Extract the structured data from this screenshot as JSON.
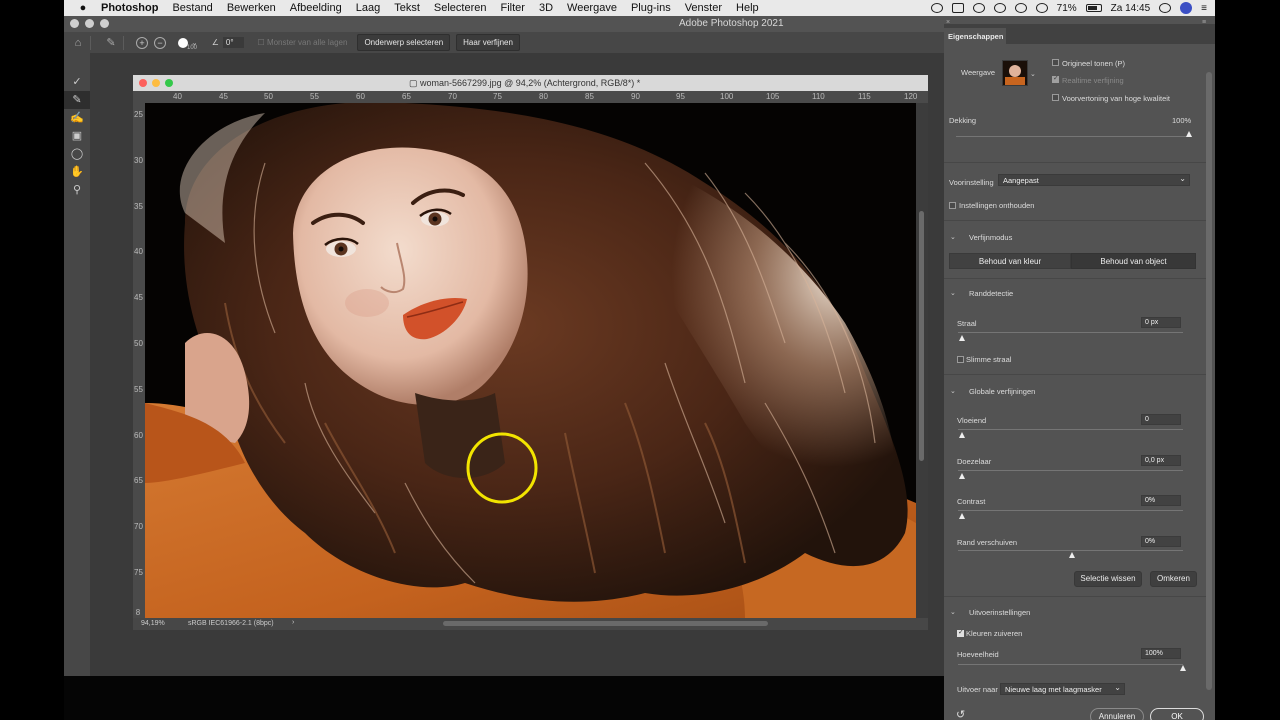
{
  "menubar": {
    "apple_icon": "apple-icon",
    "items": [
      "Photoshop",
      "Bestand",
      "Bewerken",
      "Afbeelding",
      "Laag",
      "Tekst",
      "Selecteren",
      "Filter",
      "3D",
      "Weergave",
      "Plug-ins",
      "Venster",
      "Help"
    ],
    "battery": "71%",
    "clock": "Za 14:45"
  },
  "app": {
    "title": "Adobe Photoshop 2021"
  },
  "options": {
    "brush_size": "100",
    "angle": "0°",
    "sample_all_layers": "Monster van alle lagen",
    "select_subject": "Onderwerp selecteren",
    "refine_hair": "Haar verfijnen"
  },
  "toolbar": {
    "tools": [
      "quick-selection-tool-icon",
      "refine-edge-brush-icon",
      "brush-tool-icon",
      "object-selection-tool-icon",
      "lasso-tool-icon",
      "hand-tool-icon",
      "zoom-tool-icon"
    ]
  },
  "document": {
    "title": "woman-5667299.jpg @ 94,2% (Achtergrond, RGB/8*) *",
    "ruler_top": [
      "40",
      "45",
      "50",
      "55",
      "60",
      "65",
      "70",
      "75",
      "80",
      "85",
      "90",
      "95",
      "100",
      "105",
      "110",
      "115",
      "120"
    ],
    "ruler_left": [
      "25",
      "30",
      "35",
      "40",
      "45",
      "50",
      "55",
      "60",
      "65",
      "70",
      "75",
      "8"
    ],
    "zoom": "94,19%",
    "profile": "sRGB IEC61966-2.1 (8bpc)",
    "status_arrow": "›"
  },
  "properties": {
    "tab": "Eigenschappen",
    "view_label": "Weergave",
    "original_tones": "Origineel tonen (P)",
    "realtime_refine": "Realtime verfijning",
    "hq_preview": "Voorvertoning van hoge kwaliteit",
    "opacity_label": "Dekking",
    "opacity_value": "100%",
    "preset_label": "Voorinstelling",
    "preset_value": "Aangepast",
    "remember_settings": "Instellingen onthouden",
    "refine_mode": {
      "title": "Verfijnmodus",
      "option_color": "Behoud van kleur",
      "option_object": "Behoud van object",
      "selected": "Behoud van object"
    },
    "edge_detection": {
      "title": "Randdetectie",
      "radius_label": "Straal",
      "radius_value": "0 px",
      "smart_radius": "Slimme straal"
    },
    "global_refinements": {
      "title": "Globale verfijningen",
      "smooth_label": "Vloeiend",
      "smooth_value": "0",
      "feather_label": "Doezelaar",
      "feather_value": "0,0 px",
      "contrast_label": "Contrast",
      "contrast_value": "0%",
      "shift_edge_label": "Rand verschuiven",
      "shift_edge_value": "0%"
    },
    "clear_selection": "Selectie wissen",
    "invert": "Omkeren",
    "output_settings": {
      "title": "Uitvoerinstellingen",
      "decontaminate": "Kleuren zuiveren",
      "amount_label": "Hoeveelheid",
      "amount_value": "100%",
      "output_to_label": "Uitvoer naar",
      "output_to_value": "Nieuwe laag met laagmasker"
    },
    "cancel": "Annuleren",
    "ok": "OK"
  },
  "colors": {
    "accent_ring": "#f2e400",
    "panel_bg": "#535353",
    "jacket": "#c8651f"
  }
}
